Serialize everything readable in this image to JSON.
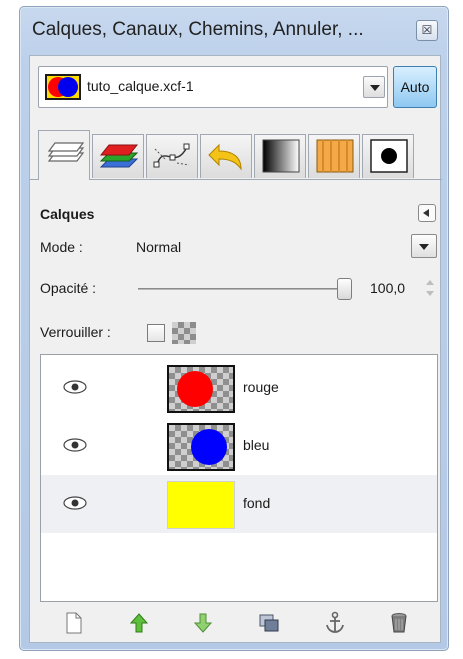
{
  "window": {
    "title": "Calques, Canaux, Chemins, Annuler, ...",
    "close_glyph": "☒"
  },
  "image_selector": {
    "value": "tuto_calque.xcf-1",
    "auto_label": "Auto"
  },
  "tabs": [
    {
      "name": "layers-tab-icon",
      "active": true
    },
    {
      "name": "channels-tab-icon",
      "active": false
    },
    {
      "name": "paths-tab-icon",
      "active": false
    },
    {
      "name": "undo-history-tab-icon",
      "active": false
    },
    {
      "name": "gradients-tab-icon",
      "active": false
    },
    {
      "name": "patterns-tab-icon",
      "active": false
    },
    {
      "name": "brushes-tab-icon",
      "active": false
    }
  ],
  "layers_panel": {
    "title": "Calques",
    "mode_label": "Mode :",
    "mode_value": "Normal",
    "opacity_label": "Opacité :",
    "opacity_value": "100,0",
    "lock_label": "Verrouiller :"
  },
  "layers": [
    {
      "name": "rouge",
      "visible": true,
      "color": "#ff0000"
    },
    {
      "name": "bleu",
      "visible": true,
      "color": "#0000ff"
    },
    {
      "name": "fond",
      "visible": true,
      "color": "#ffff00"
    }
  ],
  "toolbar": [
    "new-layer-icon",
    "raise-layer-icon",
    "lower-layer-icon",
    "duplicate-layer-icon",
    "anchor-layer-icon",
    "delete-layer-icon"
  ]
}
